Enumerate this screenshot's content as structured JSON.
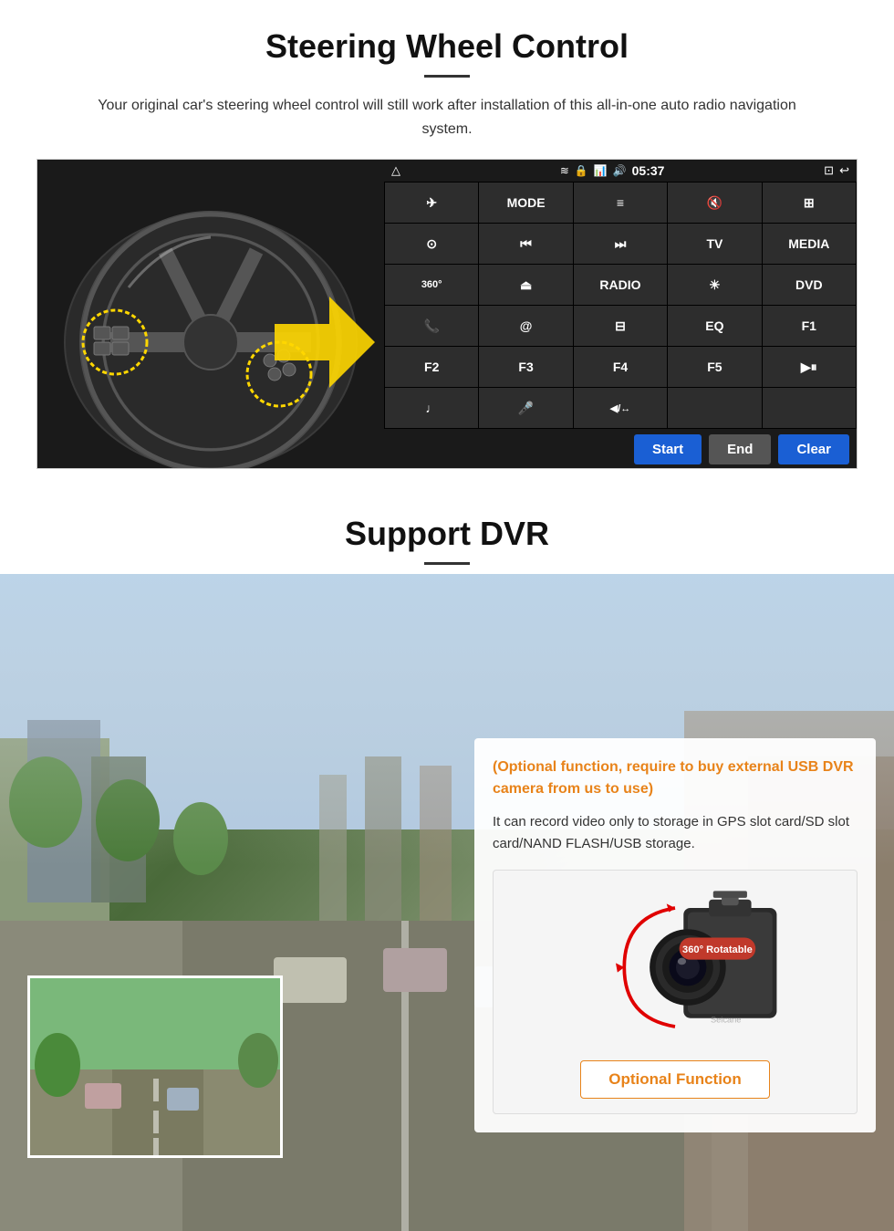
{
  "page": {
    "steering_section": {
      "title": "Steering Wheel Control",
      "description": "Your original car's steering wheel control will still work after installation of this all-in-one auto radio navigation system.",
      "radio_panel": {
        "top_bar": {
          "home_icon": "△",
          "wifi_icon": "📶",
          "lock_icon": "🔒",
          "signal_icon": "📊",
          "volume_icon": "🔊",
          "time": "05:37",
          "window_icon": "⊡",
          "back_icon": "↩"
        },
        "buttons": [
          {
            "label": "✈",
            "id": "btn-nav"
          },
          {
            "label": "MODE",
            "id": "btn-mode"
          },
          {
            "label": "≡",
            "id": "btn-menu"
          },
          {
            "label": "🔇",
            "id": "btn-mute"
          },
          {
            "label": "⊞",
            "id": "btn-apps"
          },
          {
            "label": "⊙",
            "id": "btn-settings"
          },
          {
            "label": "⏮",
            "id": "btn-prev"
          },
          {
            "label": "⏭",
            "id": "btn-next"
          },
          {
            "label": "TV",
            "id": "btn-tv"
          },
          {
            "label": "MEDIA",
            "id": "btn-media"
          },
          {
            "label": "360",
            "id": "btn-360"
          },
          {
            "label": "⏏",
            "id": "btn-eject"
          },
          {
            "label": "RADIO",
            "id": "btn-radio"
          },
          {
            "label": "☀",
            "id": "btn-brightness"
          },
          {
            "label": "DVD",
            "id": "btn-dvd"
          },
          {
            "label": "📞",
            "id": "btn-phone"
          },
          {
            "label": "@",
            "id": "btn-web"
          },
          {
            "label": "⊟",
            "id": "btn-mirror"
          },
          {
            "label": "EQ",
            "id": "btn-eq"
          },
          {
            "label": "F1",
            "id": "btn-f1"
          },
          {
            "label": "F2",
            "id": "btn-f2"
          },
          {
            "label": "F3",
            "id": "btn-f3"
          },
          {
            "label": "F4",
            "id": "btn-f4"
          },
          {
            "label": "F5",
            "id": "btn-f5"
          },
          {
            "label": "▶⏸",
            "id": "btn-playpause"
          },
          {
            "label": "♩",
            "id": "btn-music"
          },
          {
            "label": "🎤",
            "id": "btn-mic"
          },
          {
            "label": "◀/↔",
            "id": "btn-pan"
          },
          {
            "label": "",
            "id": "btn-empty1"
          },
          {
            "label": "",
            "id": "btn-empty2"
          }
        ],
        "bottom_controls": {
          "start_label": "Start",
          "end_label": "End",
          "clear_label": "Clear"
        }
      }
    },
    "dvr_section": {
      "title": "Support DVR",
      "optional_text": "(Optional function, require to buy external USB DVR camera from us to use)",
      "description_text": "It can record video only to storage in GPS slot card/SD slot card/NAND FLASH/USB storage.",
      "camera_badge": "360° Rotatable",
      "watermark": "Seicane",
      "optional_function_label": "Optional Function"
    }
  }
}
